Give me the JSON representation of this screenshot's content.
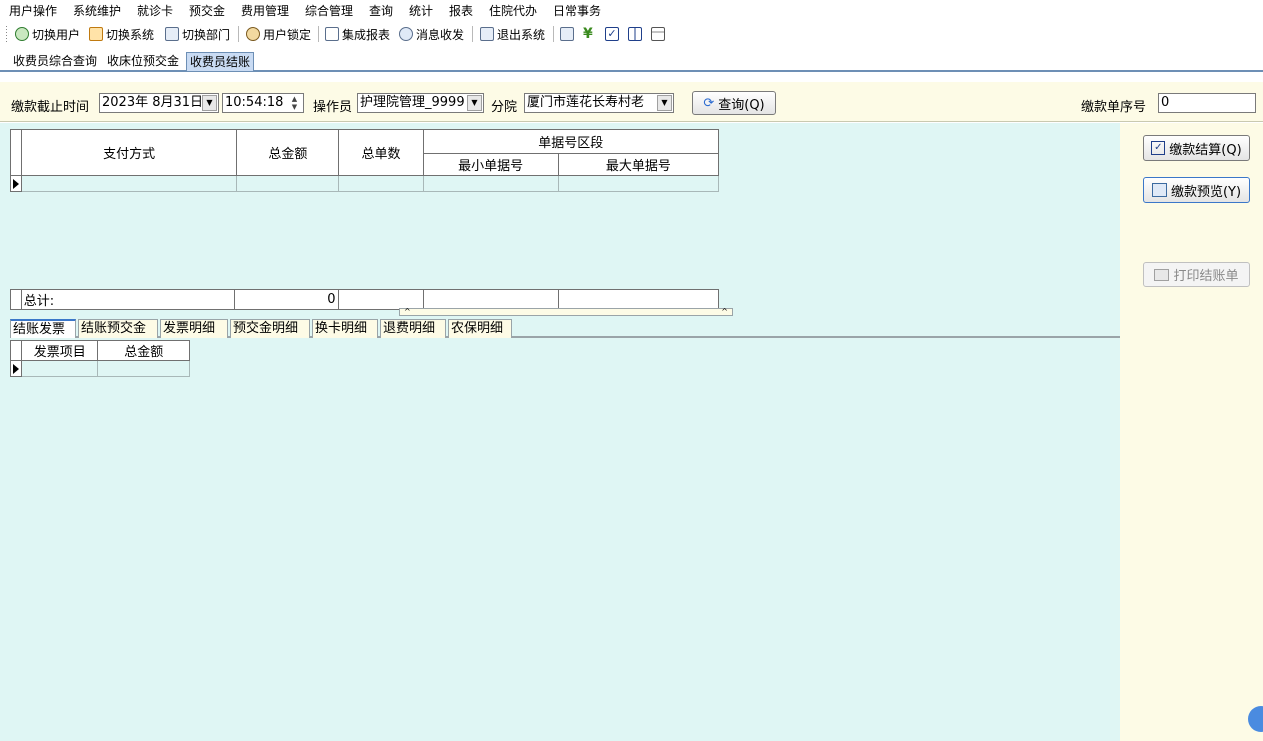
{
  "menu": [
    "用户操作",
    "系统维护",
    "就诊卡",
    "预交金",
    "费用管理",
    "综合管理",
    "查询",
    "统计",
    "报表",
    "住院代办",
    "日常事务"
  ],
  "toolbar": {
    "switch_user": "切换用户",
    "switch_system": "切换系统",
    "switch_dept": "切换部门",
    "lock_user": "用户锁定",
    "integrated_report": "集成报表",
    "messages": "消息收发",
    "exit_system": "退出系统"
  },
  "doc_tabs": [
    "收费员综合查询",
    "收床位预交金",
    "收费员结账"
  ],
  "filter": {
    "deadline_label": "缴款截止时间",
    "date_value": "2023年  8月31日",
    "time_value": "10:54:18",
    "operator_label": "操作员",
    "operator_value": "护理院管理_9999",
    "branch_label": "分院",
    "branch_value": "厦门市莲花长寿村老",
    "query_button": "查询(Q)",
    "serial_label": "缴款单序号",
    "serial_value": "0"
  },
  "summary_grid": {
    "col_pay": "支付方式",
    "col_total_amount": "总金额",
    "col_total_count": "总单数",
    "col_range": "单据号区段",
    "col_min": "最小单据号",
    "col_max": "最大单据号",
    "total_label": "总计:",
    "total_amount": "0"
  },
  "bottom_tabs": [
    "结账发票",
    "结账预交金",
    "发票明细",
    "预交金明细",
    "换卡明细",
    "退费明细",
    "农保明细"
  ],
  "invoice_grid": {
    "col_item": "发票项目",
    "col_amount": "总金额"
  },
  "right_buttons": {
    "settle": "缴款结算(Q)",
    "preview": "缴款预览(Y)",
    "print": "打印结账单"
  }
}
